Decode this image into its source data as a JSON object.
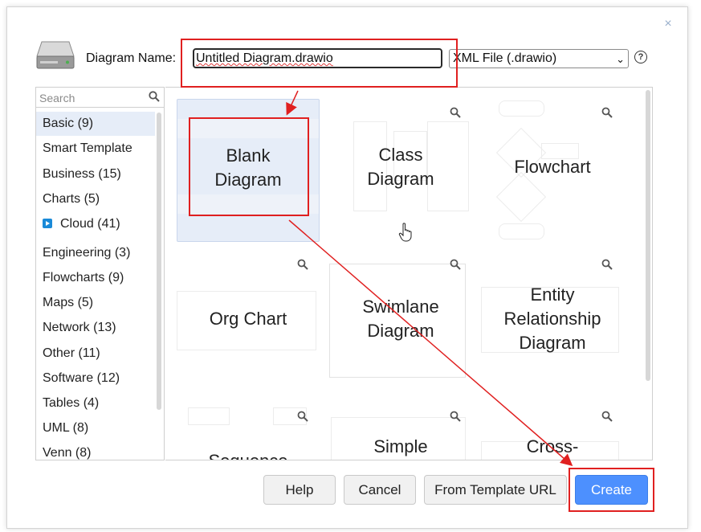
{
  "dialog": {
    "close_symbol": "×",
    "name_label": "Diagram Name:",
    "name_value": "Untitled Diagram.drawio",
    "format_value": "XML File (.drawio)",
    "help_symbol": "?"
  },
  "sidebar": {
    "search_placeholder": "Search",
    "items": [
      {
        "label": "Basic (9)"
      },
      {
        "label": "Smart Template"
      },
      {
        "label": "Business (15)"
      },
      {
        "label": "Charts (5)"
      },
      {
        "label": "Cloud (41)"
      },
      {
        "label": "Engineering (3)"
      },
      {
        "label": "Flowcharts (9)"
      },
      {
        "label": "Maps (5)"
      },
      {
        "label": "Network (13)"
      },
      {
        "label": "Other (11)"
      },
      {
        "label": "Software (12)"
      },
      {
        "label": "Tables (4)"
      },
      {
        "label": "UML (8)"
      },
      {
        "label": "Venn (8)"
      }
    ]
  },
  "templates": [
    {
      "label": "Blank\nDiagram"
    },
    {
      "label": "Class\nDiagram"
    },
    {
      "label": "Flowchart"
    },
    {
      "label": "Org Chart"
    },
    {
      "label": "Swimlane\nDiagram"
    },
    {
      "label": "Entity\nRelationship\nDiagram"
    },
    {
      "label": "Sequence"
    },
    {
      "label": "Simple"
    },
    {
      "label": "Cross-"
    }
  ],
  "buttons": {
    "help": "Help",
    "cancel": "Cancel",
    "from_template_url": "From Template URL",
    "create": "Create"
  },
  "colors": {
    "accent": "#4d90fe",
    "highlight": "#e02020",
    "selected_bg": "#e6edf8"
  },
  "icons": [
    "drive-icon",
    "close-icon",
    "help-icon",
    "search-icon",
    "zoom-icon",
    "cloud-icon",
    "hand-cursor-icon"
  ]
}
